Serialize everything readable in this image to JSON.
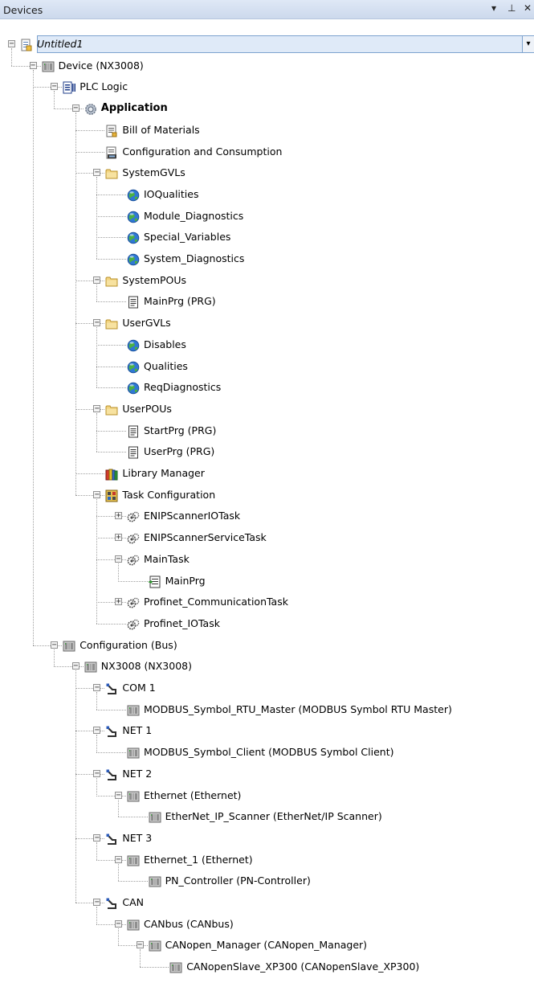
{
  "panel": {
    "title": "Devices",
    "dropdown_glyph": "▾",
    "pin_glyph": "⊥",
    "close_glyph": "✕"
  },
  "tree": [
    {
      "label": "Untitled1",
      "icon": "project-icon",
      "depth": 0,
      "expander": "minus",
      "italic": true,
      "selected": true
    },
    {
      "label": "Device (NX3008)",
      "icon": "device-icon",
      "depth": 1,
      "expander": "minus"
    },
    {
      "label": "PLC Logic",
      "icon": "plc-logic-icon",
      "depth": 2,
      "expander": "minus"
    },
    {
      "label": "Application",
      "icon": "application-gear-icon",
      "depth": 3,
      "expander": "minus",
      "bold": true
    },
    {
      "label": "Bill of Materials",
      "icon": "bill-of-materials-icon",
      "depth": 4,
      "expander": "none"
    },
    {
      "label": "Configuration and Consumption",
      "icon": "configuration-consumption-icon",
      "depth": 4,
      "expander": "none"
    },
    {
      "label": "SystemGVLs",
      "icon": "folder-icon",
      "depth": 4,
      "expander": "minus"
    },
    {
      "label": "IOQualities",
      "icon": "gvl-globe-icon",
      "depth": 5,
      "expander": "none"
    },
    {
      "label": "Module_Diagnostics",
      "icon": "gvl-globe-icon",
      "depth": 5,
      "expander": "none"
    },
    {
      "label": "Special_Variables",
      "icon": "gvl-globe-icon",
      "depth": 5,
      "expander": "none"
    },
    {
      "label": "System_Diagnostics",
      "icon": "gvl-globe-icon",
      "depth": 5,
      "expander": "none"
    },
    {
      "label": "SystemPOUs",
      "icon": "folder-icon",
      "depth": 4,
      "expander": "minus"
    },
    {
      "label": "MainPrg (PRG)",
      "icon": "pou-document-icon",
      "depth": 5,
      "expander": "none"
    },
    {
      "label": "UserGVLs",
      "icon": "folder-icon",
      "depth": 4,
      "expander": "minus"
    },
    {
      "label": "Disables",
      "icon": "gvl-globe-icon",
      "depth": 5,
      "expander": "none"
    },
    {
      "label": "Qualities",
      "icon": "gvl-globe-icon",
      "depth": 5,
      "expander": "none"
    },
    {
      "label": "ReqDiagnostics",
      "icon": "gvl-globe-icon",
      "depth": 5,
      "expander": "none"
    },
    {
      "label": "UserPOUs",
      "icon": "folder-icon",
      "depth": 4,
      "expander": "minus"
    },
    {
      "label": "StartPrg (PRG)",
      "icon": "pou-document-icon",
      "depth": 5,
      "expander": "none"
    },
    {
      "label": "UserPrg (PRG)",
      "icon": "pou-document-icon",
      "depth": 5,
      "expander": "none"
    },
    {
      "label": "Library Manager",
      "icon": "library-books-icon",
      "depth": 4,
      "expander": "none"
    },
    {
      "label": "Task Configuration",
      "icon": "task-configuration-icon",
      "depth": 4,
      "expander": "minus"
    },
    {
      "label": "ENIPScannerIOTask",
      "icon": "task-icon",
      "depth": 5,
      "expander": "plus"
    },
    {
      "label": "ENIPScannerServiceTask",
      "icon": "task-icon",
      "depth": 5,
      "expander": "plus"
    },
    {
      "label": "MainTask",
      "icon": "task-icon",
      "depth": 5,
      "expander": "minus"
    },
    {
      "label": "MainPrg",
      "icon": "program-call-icon",
      "depth": 6,
      "expander": "none"
    },
    {
      "label": "Profinet_CommunicationTask",
      "icon": "task-icon",
      "depth": 5,
      "expander": "plus"
    },
    {
      "label": "Profinet_IOTask",
      "icon": "task-icon",
      "depth": 5,
      "expander": "none"
    },
    {
      "label": "Configuration (Bus)",
      "icon": "device-icon",
      "depth": 2,
      "expander": "minus"
    },
    {
      "label": "NX3008 (NX3008)",
      "icon": "device-icon",
      "depth": 3,
      "expander": "minus"
    },
    {
      "label": "COM 1",
      "icon": "port-connector-icon",
      "depth": 4,
      "expander": "minus"
    },
    {
      "label": "MODBUS_Symbol_RTU_Master (MODBUS Symbol RTU Master)",
      "icon": "device-icon",
      "depth": 5,
      "expander": "none"
    },
    {
      "label": "NET 1",
      "icon": "port-connector-icon",
      "depth": 4,
      "expander": "minus"
    },
    {
      "label": "MODBUS_Symbol_Client (MODBUS Symbol Client)",
      "icon": "device-icon",
      "depth": 5,
      "expander": "none"
    },
    {
      "label": "NET 2",
      "icon": "port-connector-icon",
      "depth": 4,
      "expander": "minus"
    },
    {
      "label": "Ethernet (Ethernet)",
      "icon": "device-icon",
      "depth": 5,
      "expander": "minus"
    },
    {
      "label": "EtherNet_IP_Scanner (EtherNet/IP Scanner)",
      "icon": "device-icon",
      "depth": 6,
      "expander": "none"
    },
    {
      "label": "NET 3",
      "icon": "port-connector-icon",
      "depth": 4,
      "expander": "minus"
    },
    {
      "label": "Ethernet_1 (Ethernet)",
      "icon": "device-icon",
      "depth": 5,
      "expander": "minus"
    },
    {
      "label": "PN_Controller (PN-Controller)",
      "icon": "device-icon",
      "depth": 6,
      "expander": "none"
    },
    {
      "label": "CAN",
      "icon": "port-connector-icon",
      "depth": 4,
      "expander": "minus"
    },
    {
      "label": "CANbus (CANbus)",
      "icon": "device-icon",
      "depth": 5,
      "expander": "minus"
    },
    {
      "label": "CANopen_Manager (CANopen_Manager)",
      "icon": "device-icon",
      "depth": 6,
      "expander": "minus"
    },
    {
      "label": "CANopenSlave_XP300 (CANopenSlave_XP300)",
      "icon": "device-icon",
      "depth": 7,
      "expander": "none"
    }
  ]
}
